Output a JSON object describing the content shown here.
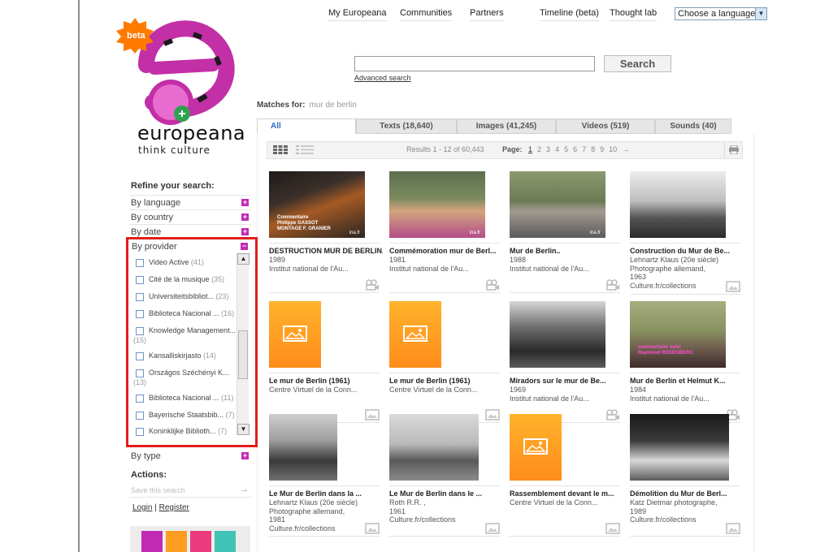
{
  "nav": {
    "items": [
      "My Europeana",
      "Communities",
      "Partners",
      "Timeline (beta)",
      "Thought lab"
    ],
    "language_select": "Choose a language"
  },
  "logo": {
    "badge": "beta",
    "wordmark": "europeana",
    "tagline": "think culture"
  },
  "search": {
    "value": "",
    "button": "Search",
    "advanced": "Advanced search"
  },
  "matches": {
    "label": "Matches for:",
    "query": "mur de berlin"
  },
  "tabs": [
    "All",
    "Texts (18,640)",
    "Images (41,245)",
    "Videos (519)",
    "Sounds (40)"
  ],
  "results_bar": {
    "count": "Results 1 - 12 of 60,443",
    "page_label": "Page:",
    "pages": [
      "1",
      "2",
      "3",
      "4",
      "5",
      "6",
      "7",
      "8",
      "9",
      "10"
    ],
    "next": "→"
  },
  "sidebar": {
    "refine_title": "Refine your search:",
    "facets": [
      "By language",
      "By country",
      "By date",
      "By provider"
    ],
    "by_type": "By type",
    "providers": [
      {
        "name": "Video Active",
        "count": "(41)"
      },
      {
        "name": "Cité de la musique",
        "count": "(35)"
      },
      {
        "name": "Universiteitsbibliot...",
        "count": "(23)"
      },
      {
        "name": "Biblioteca Nacional ...",
        "count": "(16)"
      },
      {
        "name": "Knowledge Management...",
        "count": "(15)"
      },
      {
        "name": "Kansalliskirjasto",
        "count": "(14)"
      },
      {
        "name": "Országos Széchényi K...",
        "count": "(13)"
      },
      {
        "name": "Biblioteca Nacional ...",
        "count": "(11)"
      },
      {
        "name": "Bayerische Staatsbib...",
        "count": "(7)"
      },
      {
        "name": "Koninklijke Biblioth...",
        "count": "(7)"
      }
    ],
    "actions_title": "Actions:",
    "save_search": "Save this search",
    "login": "Login",
    "separator": "|",
    "register": "Register"
  },
  "results": [
    {
      "title": "DESTRUCTION MUR DE BERLIN...",
      "lines": [
        "1989",
        "Institut national de l'Au..."
      ],
      "media": "video-icon",
      "thumb": "photo",
      "overlay": [
        "Commentaire",
        "Philippe GASSOT",
        "MONTAGE   F. GRANIER"
      ],
      "watermark": "ina.fr"
    },
    {
      "title": "Commémoration mur de Berl...",
      "lines": [
        "1981",
        "Institut national de l'Au..."
      ],
      "media": "video-icon",
      "thumb": "photo",
      "watermark": "ina.fr"
    },
    {
      "title": "Mur de Berlin..",
      "lines": [
        "1988",
        "Institut national de l'Au..."
      ],
      "media": "video-icon",
      "thumb": "photo",
      "watermark": "ina.fr"
    },
    {
      "title": "Construction du Mur de Be...",
      "lines": [
        "Lehnartz Klaus (20e siècle)",
        "Photographe allemand,",
        "1963",
        "Culture.fr/collections"
      ],
      "media": "image-icon",
      "thumb": "photo"
    },
    {
      "title": "Le mur de Berlin (1961)",
      "lines": [
        "Centre Virtuel de la Conn..."
      ],
      "media": "image-icon",
      "thumb": "placeholder"
    },
    {
      "title": "Le mur de Berlin (1961)",
      "lines": [
        "Centre Virtuel de la Conn..."
      ],
      "media": "image-icon",
      "thumb": "placeholder"
    },
    {
      "title": "Miradors sur le mur de Be...",
      "lines": [
        "1969",
        "Institut national de l'Au..."
      ],
      "media": "video-icon",
      "thumb": "photo"
    },
    {
      "title": "Mur de Berlin et Helmut K...",
      "lines": [
        "1984",
        "Institut national de l'Au..."
      ],
      "media": "video-icon",
      "thumb": "photo",
      "overlay": [
        "commentaire suivi",
        "Raymond ROSENBERG"
      ]
    },
    {
      "title": "Le Mur de Berlin dans la ...",
      "lines": [
        "Lehnartz Klaus (20e siècle)",
        "Photographe allemand,",
        "1981",
        "Culture.fr/collections"
      ],
      "media": "image-icon",
      "thumb": "photo"
    },
    {
      "title": "Le Mur de Berlin dans le ...",
      "lines": [
        "Roth R.R. ,",
        "1961",
        "Culture.fr/collections"
      ],
      "media": "image-icon",
      "thumb": "photo"
    },
    {
      "title": "Rassemblement devant le m...",
      "lines": [
        "Centre Virtuel de la Conn..."
      ],
      "media": "image-icon",
      "thumb": "placeholder"
    },
    {
      "title": "Démolition du Mur de Berl...",
      "lines": [
        "Katz Dietmar photographe,",
        "1989",
        "Culture.fr/collections"
      ],
      "media": "image-icon",
      "thumb": "photo"
    }
  ],
  "colors": {
    "accent": "#c12bb4",
    "highlight": "#e21c1c",
    "placeholder": "#ff9d22",
    "link": "#2a6dc0"
  }
}
